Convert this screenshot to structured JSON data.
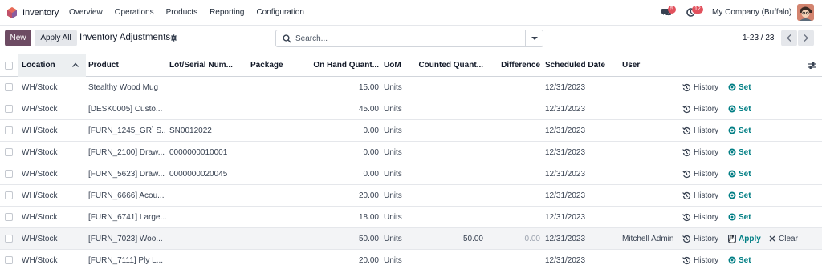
{
  "nav": {
    "app_name": "Inventory",
    "menu": [
      "Overview",
      "Operations",
      "Products",
      "Reporting",
      "Configuration"
    ],
    "messages_count": "5",
    "activities_count": "12",
    "company": "My Company (Buffalo)",
    "brand_color": "#6d4b63",
    "badge_color": "#e2515d"
  },
  "toolbar": {
    "new_label": "New",
    "apply_all_label": "Apply All",
    "title": "Inventory Adjustments",
    "search_placeholder": "Search...",
    "pager_value": "1-23 / 23"
  },
  "table": {
    "columns": {
      "location": "Location",
      "product": "Product",
      "lot": "Lot/Serial Num...",
      "package": "Package",
      "on_hand": "On Hand Quant...",
      "uom": "UoM",
      "counted": "Counted Quant...",
      "difference": "Difference",
      "scheduled": "Scheduled Date",
      "user": "User"
    },
    "rows": [
      {
        "location": "WH/Stock",
        "product": "Stealthy Wood Mug",
        "lot": "",
        "on_hand": "15.00",
        "uom": "Units",
        "counted": "",
        "difference": "",
        "scheduled": "12/31/2023",
        "user": "",
        "history": "History",
        "action": "Set"
      },
      {
        "location": "WH/Stock",
        "product": "[DESK0005] Custo...",
        "lot": "",
        "on_hand": "45.00",
        "uom": "Units",
        "counted": "",
        "difference": "",
        "scheduled": "12/31/2023",
        "user": "",
        "history": "History",
        "action": "Set"
      },
      {
        "location": "WH/Stock",
        "product": "[FURN_1245_GR] S...",
        "lot": "SN0012022",
        "on_hand": "0.00",
        "uom": "Units",
        "counted": "",
        "difference": "",
        "scheduled": "12/31/2023",
        "user": "",
        "history": "History",
        "action": "Set"
      },
      {
        "location": "WH/Stock",
        "product": "[FURN_2100] Draw...",
        "lot": "0000000010001",
        "on_hand": "0.00",
        "uom": "Units",
        "counted": "",
        "difference": "",
        "scheduled": "12/31/2023",
        "user": "",
        "history": "History",
        "action": "Set"
      },
      {
        "location": "WH/Stock",
        "product": "[FURN_5623] Draw...",
        "lot": "0000000020045",
        "on_hand": "0.00",
        "uom": "Units",
        "counted": "",
        "difference": "",
        "scheduled": "12/31/2023",
        "user": "",
        "history": "History",
        "action": "Set"
      },
      {
        "location": "WH/Stock",
        "product": "[FURN_6666] Acou...",
        "lot": "",
        "on_hand": "20.00",
        "uom": "Units",
        "counted": "",
        "difference": "",
        "scheduled": "12/31/2023",
        "user": "",
        "history": "History",
        "action": "Set"
      },
      {
        "location": "WH/Stock",
        "product": "[FURN_6741] Large...",
        "lot": "",
        "on_hand": "18.00",
        "uom": "Units",
        "counted": "",
        "difference": "",
        "scheduled": "12/31/2023",
        "user": "",
        "history": "History",
        "action": "Set"
      },
      {
        "location": "WH/Stock",
        "product": "[FURN_7023] Woo...",
        "lot": "",
        "on_hand": "50.00",
        "uom": "Units",
        "counted": "50.00",
        "difference": "0.00",
        "scheduled": "12/31/2023",
        "user": "Mitchell Admin",
        "history": "History",
        "action": "Apply",
        "clear": "Clear"
      },
      {
        "location": "WH/Stock",
        "product": "[FURN_7111] Ply L...",
        "lot": "",
        "on_hand": "20.00",
        "uom": "Units",
        "counted": "",
        "difference": "",
        "scheduled": "12/31/2023",
        "user": "",
        "history": "History",
        "action": "Set"
      }
    ]
  }
}
